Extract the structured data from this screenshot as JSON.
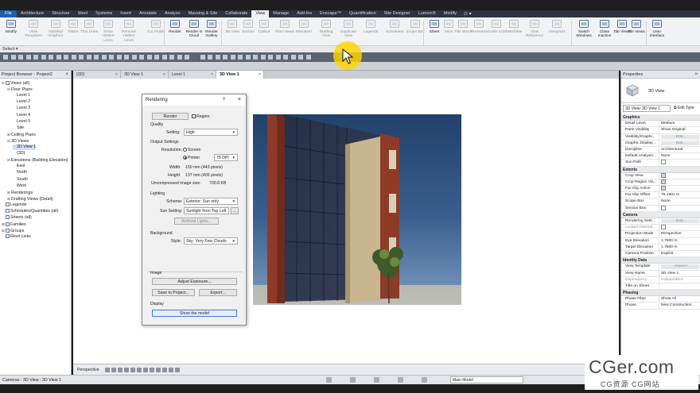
{
  "ribbon": {
    "file_tab": "File",
    "tabs": [
      "Architecture",
      "Structure",
      "Steel",
      "Systems",
      "Insert",
      "Annotate",
      "Analyze",
      "Massing & Site",
      "Collaborate",
      "View",
      "Manage",
      "Add-Ins",
      "Enscape™",
      "Quantification",
      "Site Designer",
      "Lumion®",
      "Modify"
    ],
    "active_tab": "View",
    "extra": "⊙ ▾",
    "buttons": [
      {
        "label": "Modify",
        "enabled": true
      },
      {
        "label": "View Templates",
        "enabled": false
      },
      {
        "label": "Visibility/ Graphics",
        "enabled": false
      },
      {
        "label": "Filters",
        "enabled": false
      },
      {
        "label": "Thin Lines",
        "enabled": false
      },
      {
        "label": "Show Hidden Lines",
        "enabled": false
      },
      {
        "label": "Remove Hidden Lines",
        "enabled": false
      },
      {
        "label": "Cut Profile",
        "enabled": false
      },
      {
        "label": "Render",
        "enabled": true
      },
      {
        "label": "Render in Cloud",
        "enabled": true
      },
      {
        "label": "Render Gallery",
        "enabled": true
      },
      {
        "label": "3D View",
        "enabled": false
      },
      {
        "label": "Section",
        "enabled": false
      },
      {
        "label": "Callout",
        "enabled": false
      },
      {
        "label": "Plan Views",
        "enabled": false
      },
      {
        "label": "Elevation",
        "enabled": false
      },
      {
        "label": "Drafting View",
        "enabled": false
      },
      {
        "label": "Duplicate View",
        "enabled": false
      },
      {
        "label": "Legends",
        "enabled": false
      },
      {
        "label": "Schedules",
        "enabled": false
      },
      {
        "label": "Scope Box",
        "enabled": false
      },
      {
        "label": "Sheet",
        "enabled": true
      },
      {
        "label": "View",
        "enabled": false
      },
      {
        "label": "Title Block",
        "enabled": false
      },
      {
        "label": "Revisions",
        "enabled": false
      },
      {
        "label": "Guide Grid",
        "enabled": false
      },
      {
        "label": "Matchline",
        "enabled": false
      },
      {
        "label": "View Reference",
        "enabled": false
      },
      {
        "label": "Viewports",
        "enabled": false
      },
      {
        "label": "Switch Windows",
        "enabled": true
      },
      {
        "label": "Close Inactive",
        "enabled": true
      },
      {
        "label": "Tab Views",
        "enabled": true
      },
      {
        "label": "Tile Views",
        "enabled": true
      },
      {
        "label": "User Interface",
        "enabled": true
      }
    ],
    "groups": {
      "graphics": "Graphics",
      "presentation": "Presentation",
      "create": "Create",
      "sheet_composition": "Sheet Composition",
      "windows": "Windows"
    },
    "select_label": "Select ▾"
  },
  "project_browser": {
    "title": "Project Browser - Project2",
    "close": "×",
    "items": [
      {
        "label": "Views (all)",
        "level": 0,
        "tw": "⊟",
        "icon": true
      },
      {
        "label": "Floor Plans",
        "level": 1,
        "tw": "⊟"
      },
      {
        "label": "Level 1",
        "level": 2
      },
      {
        "label": "Level 2",
        "level": 2
      },
      {
        "label": "Level 3",
        "level": 2
      },
      {
        "label": "Level 4",
        "level": 2
      },
      {
        "label": "Level 5",
        "level": 2
      },
      {
        "label": "Site",
        "level": 2
      },
      {
        "label": "Ceiling Plans",
        "level": 1,
        "tw": "⊞"
      },
      {
        "label": "3D Views",
        "level": 1,
        "tw": "⊟"
      },
      {
        "label": "3D View 1",
        "level": 2,
        "selected": true
      },
      {
        "label": "{3D}",
        "level": 2
      },
      {
        "label": "Elevations (Building Elevation)",
        "level": 1,
        "tw": "⊟"
      },
      {
        "label": "East",
        "level": 2
      },
      {
        "label": "North",
        "level": 2
      },
      {
        "label": "South",
        "level": 2
      },
      {
        "label": "West",
        "level": 2
      },
      {
        "label": "Renderings",
        "level": 1,
        "tw": "⊞"
      },
      {
        "label": "Drafting Views (Detail)",
        "level": 1,
        "tw": "⊞"
      },
      {
        "label": "Legends",
        "level": 0,
        "icon": true
      },
      {
        "label": "Schedules/Quantities (all)",
        "level": 0,
        "icon": true
      },
      {
        "label": "Sheets (all)",
        "level": 0,
        "icon": true
      },
      {
        "label": "Families",
        "level": 0,
        "tw": "⊞",
        "icon": true
      },
      {
        "label": "Groups",
        "level": 0,
        "tw": "⊞",
        "icon": true
      },
      {
        "label": "Revit Links",
        "level": 0,
        "icon": true
      }
    ]
  },
  "view_tabs": [
    {
      "label": "{3D}",
      "active": false
    },
    {
      "label": "3D View 1",
      "active": false
    },
    {
      "label": "Level 1",
      "active": false
    },
    {
      "label": "3D View 1",
      "active": true
    }
  ],
  "rendering_dialog": {
    "title": "Rendering",
    "help": "?",
    "close": "×",
    "render_button": "Render",
    "region_label": "Region",
    "quality_label": "Quality",
    "settings_label": "Setting:",
    "settings_value": "High",
    "output_label": "Output Settings",
    "resolution_label": "Resolution:",
    "screen_label": "Screen",
    "printer_label": "Printer",
    "dpi_value": "75 DPI",
    "width_label": "Width:",
    "width_value": "150 mm (443 pixels)",
    "height_label": "Height:",
    "height_value": "137 mm (405 pixels)",
    "image_size_label": "Uncompressed image size:",
    "image_size_value": "700.8 KB",
    "lighting_label": "Lighting",
    "scheme_label": "Scheme:",
    "scheme_value": "Exterior: Sun only",
    "sun_label": "Sun Setting:",
    "sun_value": "Sunlight from Top Left",
    "sun_more": "...",
    "artificial_button": "Artificial Lights...",
    "background_label": "Background",
    "style_label": "Style:",
    "style_value": "Sky: Very Few Clouds",
    "image_label": "Image",
    "adjust_button": "Adjust Exposure...",
    "save_button": "Save to Project...",
    "export_button": "Export...",
    "display_label": "Display",
    "show_button": "Show the model"
  },
  "properties": {
    "title": "Properties",
    "close": "×",
    "type_label": "3D View",
    "instance_select": "3D View: 3D View 1",
    "edit_type": "Edit Type",
    "sections": [
      {
        "title": "Graphics",
        "rows": [
          {
            "k": "Detail Level",
            "v": "Medium"
          },
          {
            "k": "Parts Visibility",
            "v": "Show Original"
          },
          {
            "k": "Visibility/Graphi...",
            "v": "Edit...",
            "t": "btn"
          },
          {
            "k": "Graphic Display...",
            "v": "Edit...",
            "t": "btn"
          },
          {
            "k": "Discipline",
            "v": "Architectural"
          },
          {
            "k": "Default Analysis...",
            "v": "None"
          },
          {
            "k": "Sun Path",
            "v": "",
            "t": "chk"
          }
        ]
      },
      {
        "title": "Extents",
        "rows": [
          {
            "k": "Crop View",
            "v": "",
            "t": "chk on"
          },
          {
            "k": "Crop Region Vis...",
            "v": "",
            "t": "chk on"
          },
          {
            "k": "Far Clip Active",
            "v": "",
            "t": "chk on"
          },
          {
            "k": "Far Clip Offset",
            "v": "75.1801 m"
          },
          {
            "k": "Scope Box",
            "v": "None"
          },
          {
            "k": "Section Box",
            "v": "",
            "t": "chk"
          }
        ]
      },
      {
        "title": "Camera",
        "rows": [
          {
            "k": "Rendering Setti...",
            "v": "Edit...",
            "t": "btn"
          },
          {
            "k": "Locked Orientat...",
            "v": "",
            "t": "chk",
            "dim": true
          },
          {
            "k": "Projection Mode",
            "v": "Perspective"
          },
          {
            "k": "Eye Elevation",
            "v": "1.7500 m"
          },
          {
            "k": "Target Elevation",
            "v": "1.7500 m"
          },
          {
            "k": "Camera Position",
            "v": "Explicit"
          }
        ]
      },
      {
        "title": "Identity Data",
        "rows": [
          {
            "k": "View Template",
            "v": "<None>",
            "t": "btn"
          },
          {
            "k": "View Name",
            "v": "3D View 1"
          },
          {
            "k": "Dependency",
            "v": "Independent",
            "dim": true
          },
          {
            "k": "Title on Sheet",
            "v": ""
          }
        ]
      },
      {
        "title": "Phasing",
        "rows": [
          {
            "k": "Phase Filter",
            "v": "Show All"
          },
          {
            "k": "Phase",
            "v": "New Construction"
          }
        ]
      }
    ]
  },
  "view_control": {
    "mode_label": "Perspective"
  },
  "status_bar": {
    "text": "Cameras : 3D View : 3D View 1",
    "workset": "Main Model"
  },
  "watermark": {
    "big": "CGer.com",
    "small": "CG资源 CG网站"
  },
  "colors": {
    "ribbon_dark": "#2b3440",
    "file_tab": "#1f5fa8",
    "highlight": "#ffd600",
    "sky": "#2b4d78",
    "brick": "#8d3b27"
  }
}
